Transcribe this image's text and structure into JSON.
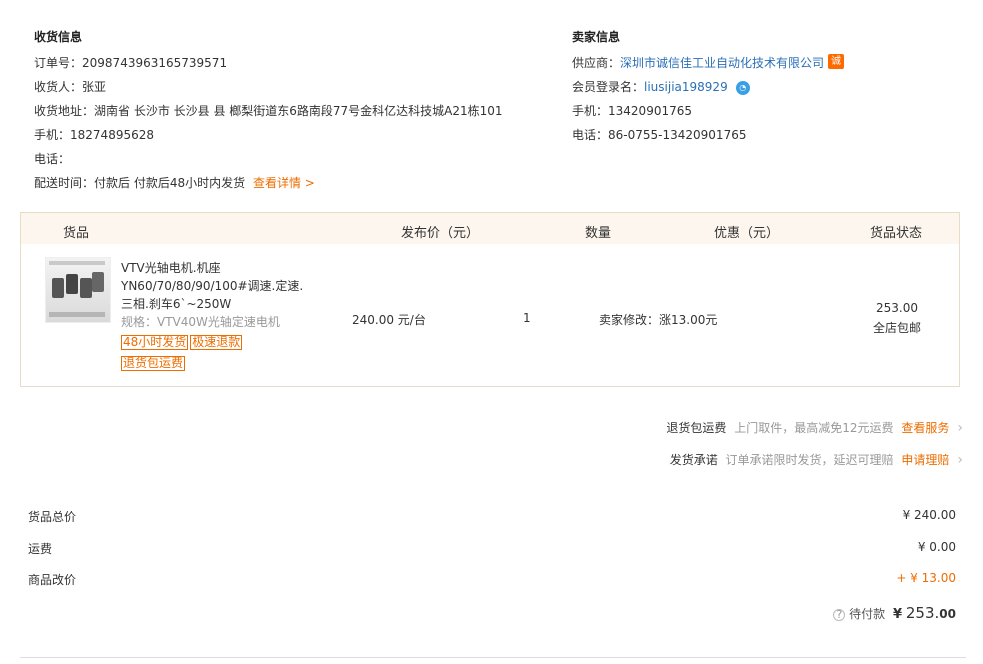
{
  "receiver": {
    "title": "收货信息",
    "order_no_label": "订单号：",
    "order_no": "2098743963165739571",
    "name_label": "收货人：",
    "name": "张亚",
    "address_label": "收货地址：",
    "address": "湖南省 长沙市 长沙县 县 榔梨街道东6路南段77号金科亿达科技城A21栋101",
    "mobile_label": "手机：",
    "mobile": "18274895628",
    "phone_label": "电话：",
    "phone": "",
    "delivery_label": "配送时间：",
    "delivery": "付款后 付款后48小时内发货",
    "details_link": "查看详情 >"
  },
  "seller": {
    "title": "卖家信息",
    "supplier_label": "供应商：",
    "supplier": "深圳市诚信佳工业自动化技术有限公司",
    "supplier_badge": "诚",
    "member_label": "会员登录名：",
    "member": "liusijia198929",
    "mobile_label": "手机：",
    "mobile": "13420901765",
    "phone_label": "电话：",
    "phone": "86-0755-13420901765"
  },
  "table": {
    "headers": {
      "goods": "货品",
      "price": "发布价（元）",
      "qty": "数量",
      "discount": "优惠（元）",
      "status": "货品状态"
    },
    "item": {
      "title_line1": "VTV光轴电机.机座",
      "title_line2": "YN60/70/80/90/100#调速.定速.",
      "title_line3": "三相.刹车6`~250W",
      "spec": "规格：VTV40W光轴定速电机",
      "tags": [
        "48小时发货",
        "极速退款",
        "退货包运费"
      ],
      "price": "240.00 元/台",
      "qty": "1",
      "discount": "卖家修改：涨13.00元",
      "status_amount": "253.00",
      "status_shipping": "全店包邮"
    }
  },
  "services": [
    {
      "name": "退货包运费",
      "desc": "上门取件，最高减免12元运费",
      "action": "查看服务"
    },
    {
      "name": "发货承诺",
      "desc": "订单承诺限时发货，延迟可理赔",
      "action": "申请理赔"
    }
  ],
  "summary": {
    "goods_total_label": "货品总价",
    "goods_total": "¥ 240.00",
    "shipping_label": "运费",
    "shipping": "¥ 0.00",
    "change_label": "商品改价",
    "change": "+ ¥ 13.00",
    "pay_label": "待付款",
    "pay_currency": "¥",
    "pay_amount_int": "253.",
    "pay_amount_dec": "00"
  },
  "colors": {
    "accent": "#ed6d00",
    "link": "#2a6fb7",
    "table_header_bg": "#fdf6ee"
  }
}
